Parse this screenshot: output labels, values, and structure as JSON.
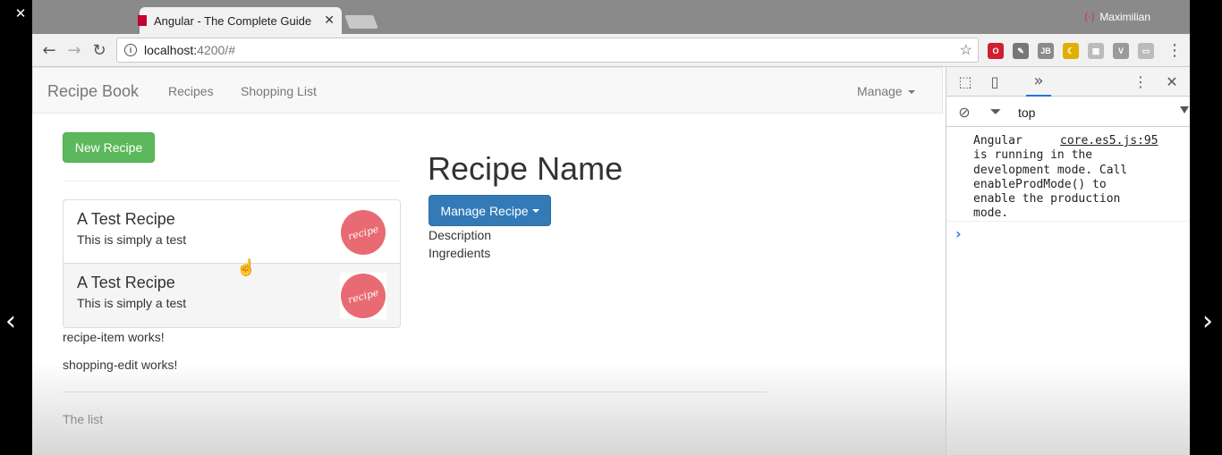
{
  "player": {
    "close_glyph": "✕",
    "restore_glyph": "⧉",
    "minimize_glyph": "—",
    "prev_glyph": "‹",
    "next_glyph": "›"
  },
  "browser": {
    "tab_title": "Angular - The Complete Guide",
    "tab_close": "✕",
    "profile_name": "Maximilian",
    "url_host": "localhost:",
    "url_path": "4200/#",
    "back_glyph": "←",
    "forward_glyph": "→",
    "reload_glyph": "↻",
    "star_glyph": "☆",
    "menu_glyph": "⋮",
    "extensions": [
      {
        "name": "opera-icon",
        "label": "O",
        "color": "#d02030"
      },
      {
        "name": "eyedropper-icon",
        "label": "✎",
        "color": "#777777"
      },
      {
        "name": "jb-icon",
        "label": "JB",
        "color": "#8a8a8a"
      },
      {
        "name": "moon-icon",
        "label": "☾",
        "color": "#e0b000"
      },
      {
        "name": "grid-icon",
        "label": "▦",
        "color": "#bbbbbb"
      },
      {
        "name": "vue-icon",
        "label": "V",
        "color": "#9a9a9a"
      },
      {
        "name": "cast-icon",
        "label": "▭",
        "color": "#bbbbbb"
      }
    ]
  },
  "navbar": {
    "brand": "Recipe Book",
    "links": [
      "Recipes",
      "Shopping List"
    ],
    "manage": "Manage"
  },
  "recipes": {
    "new_button": "New Recipe",
    "items": [
      {
        "title": "A Test Recipe",
        "description": "This is simply a test",
        "image_text": "recipe"
      },
      {
        "title": "A Test Recipe",
        "description": "This is simply a test",
        "image_text": "recipe"
      }
    ],
    "recipe_item_text": "recipe-item works!"
  },
  "detail": {
    "name": "Recipe Name",
    "manage_button": "Manage Recipe",
    "description": "Description",
    "ingredients": "Ingredients"
  },
  "shopping": {
    "edit_text": "shopping-edit works!",
    "list_text": "The list"
  },
  "devtools": {
    "context": "top",
    "message": "Angular is running in the development mode. Call enableProdMode() to enable the production mode.",
    "source": "core.es5.js:95",
    "prompt": "›"
  },
  "colors": {
    "success": "#5cb85c",
    "primary": "#337ab7",
    "recipe_image": "#e86a72"
  }
}
